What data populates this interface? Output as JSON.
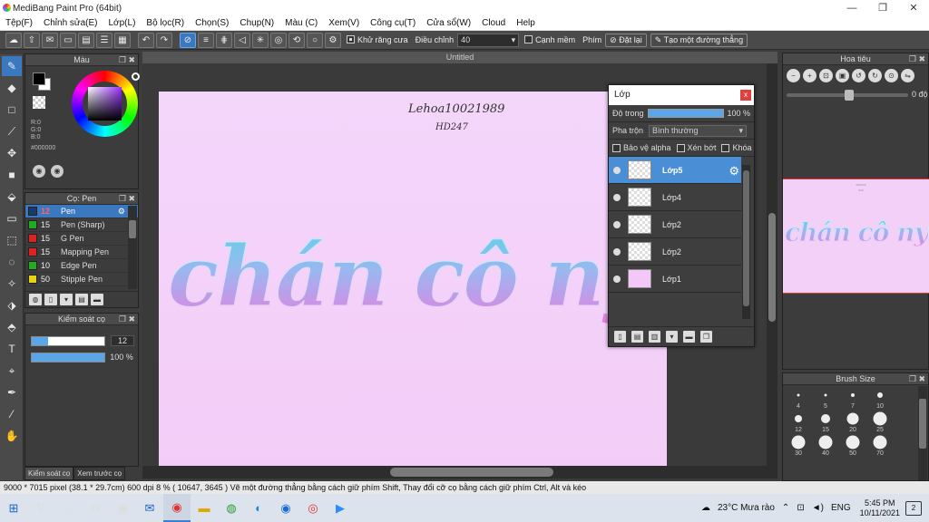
{
  "window": {
    "title": "MediBang Paint Pro (64bit)",
    "minimize": "—",
    "restore": "❐",
    "close": "✕"
  },
  "menu": [
    "Tệp(F)",
    "Chỉnh sửa(E)",
    "Lớp(L)",
    "Bộ lọc(R)",
    "Chọn(S)",
    "Chụp(N)",
    "Màu (C)",
    "Xem(V)",
    "Công cụ(T)",
    "Cửa sổ(W)",
    "Cloud",
    "Help"
  ],
  "toolbar": {
    "antialias": "Khử răng cưa",
    "adjust_label": "Điều chỉnh",
    "adjust_value": "40",
    "soft_edge": "Cạnh mềm",
    "pen_label": "Phím",
    "reset": "Đặt lại",
    "straight_line": "Tạo một đường thẳng"
  },
  "color_panel": {
    "title": "Màu",
    "r": "R:0",
    "g": "G:0",
    "b": "B:0",
    "hex": "#000000"
  },
  "brush_panel": {
    "title": "Cọ: Pen",
    "items": [
      {
        "size": "12",
        "name": "Pen",
        "color": "#1a3a6a"
      },
      {
        "size": "15",
        "name": "Pen (Sharp)",
        "color": "#22aa22"
      },
      {
        "size": "15",
        "name": "G Pen",
        "color": "#dd2222"
      },
      {
        "size": "15",
        "name": "Mapping Pen",
        "color": "#dd2222"
      },
      {
        "size": "10",
        "name": "Edge Pen",
        "color": "#22aa22"
      },
      {
        "size": "50",
        "name": "Stipple Pen",
        "color": "#e6d21a"
      }
    ]
  },
  "size_panel": {
    "title": "Kiểm soát cọ",
    "size": "12",
    "opacity": "100 %",
    "opacity_level": 1.0
  },
  "left_tabs": [
    "Kiểm soát cọ",
    "Xem trước cọ"
  ],
  "document": {
    "tab": "Untitled",
    "signature_line1": "Lehoa10021989",
    "signature_line2": "HD247",
    "lettering": "chán cô ny"
  },
  "layer_panel": {
    "title": "Lớp",
    "close": "x",
    "opacity_label": "Độ trong",
    "opacity_value": "100 %",
    "opacity_level": 1.0,
    "blend_label": "Pha trộn",
    "blend_value": "Bình thường",
    "protect_alpha": "Bảo vệ alpha",
    "clipping": "Xén bớt",
    "lock": "Khóa",
    "layers": [
      {
        "name": "Lớp5",
        "selected": true
      },
      {
        "name": "Lớp4"
      },
      {
        "name": "Lớp2"
      },
      {
        "name": "Lớp2"
      },
      {
        "name": "Lớp1"
      }
    ]
  },
  "navigator": {
    "title": "Hoa tiêu",
    "rotation": "0 độ",
    "preview_text": "chán cô ny"
  },
  "brush_size": {
    "title": "Brush Size",
    "sizes": [
      "4",
      "5",
      "7",
      "10",
      "12",
      "15",
      "20",
      "25",
      "30",
      "40",
      "50",
      "70"
    ],
    "dots": [
      3,
      3,
      4,
      6,
      8,
      10,
      13,
      16,
      18,
      20,
      22,
      24
    ]
  },
  "status": "9000 * 7015 pixel   (38.1 * 29.7cm)   600 dpi   8 %   ( 10647, 3645 )   Vẽ một đường thẳng bằng cách giữ phím Shift, Thay đổi cỡ cọ bằng cách giữ phím Ctrl, Alt và kéo",
  "taskbar": {
    "weather": "23°C  Mưa rào",
    "lang": "ENG",
    "time": "5:45 PM",
    "date": "10/11/2021",
    "notifications": "2"
  },
  "colors": {
    "accent": "#3a78c0",
    "panel": "#3c3c3c",
    "paper": "#f4d6fb"
  }
}
